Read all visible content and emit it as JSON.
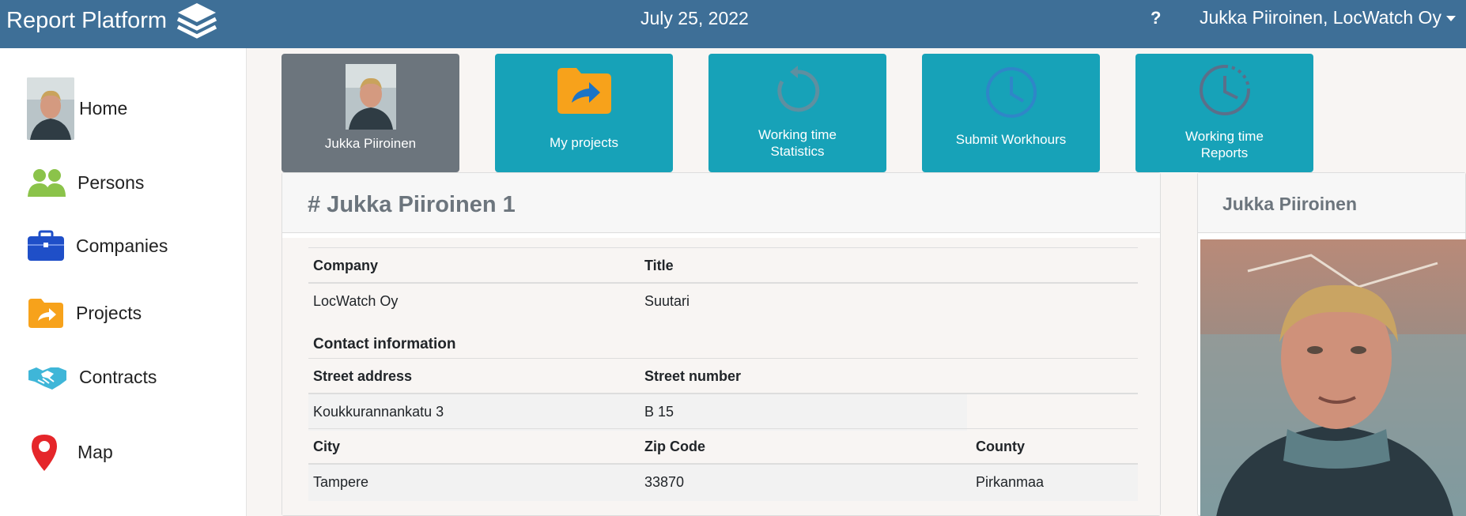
{
  "topbar": {
    "brand": "Report Platform",
    "date": "July 25, 2022",
    "help": "?",
    "user": "Jukka Piiroinen, LocWatch Oy"
  },
  "sidebar": {
    "items": [
      {
        "label": "Home",
        "icon": "avatar"
      },
      {
        "label": "Persons",
        "icon": "persons-icon"
      },
      {
        "label": "Companies",
        "icon": "briefcase-icon"
      },
      {
        "label": "Projects",
        "icon": "folder-share-icon"
      },
      {
        "label": "Contracts",
        "icon": "handshake-icon"
      },
      {
        "label": "Map",
        "icon": "map-pin-icon"
      }
    ]
  },
  "tiles": [
    {
      "label": "Jukka Piiroinen"
    },
    {
      "label": "My projects"
    },
    {
      "label_line1": "Working time",
      "label_line2": "Statistics"
    },
    {
      "label": "Submit Workhours"
    },
    {
      "label_line1": "Working time",
      "label_line2": "Reports"
    }
  ],
  "main": {
    "title": "# Jukka Piiroinen 1",
    "headers1": {
      "company": "Company",
      "title": "Title"
    },
    "values1": {
      "company": "LocWatch Oy",
      "title": "Suutari"
    },
    "contact_title": "Contact information",
    "headers2": {
      "street_address": "Street address",
      "street_number": "Street number"
    },
    "values2": {
      "street_address": "Koukkurannankatu 3",
      "street_number": "B 15"
    },
    "headers3": {
      "city": "City",
      "zip": "Zip Code",
      "county": "County"
    },
    "values3": {
      "city": "Tampere",
      "zip": "33870",
      "county": "Pirkanmaa"
    }
  },
  "profile": {
    "name": "Jukka Piiroinen"
  },
  "colors": {
    "topbar": "#3e6f97",
    "tile": "#17a2b8",
    "tile_grey": "#6c757d",
    "persons_green": "#8bc34a",
    "briefcase_blue": "#1f4fc8",
    "folder_orange": "#f7a21b",
    "handshake_teal": "#3fb6d8",
    "map_red": "#e5262a"
  }
}
